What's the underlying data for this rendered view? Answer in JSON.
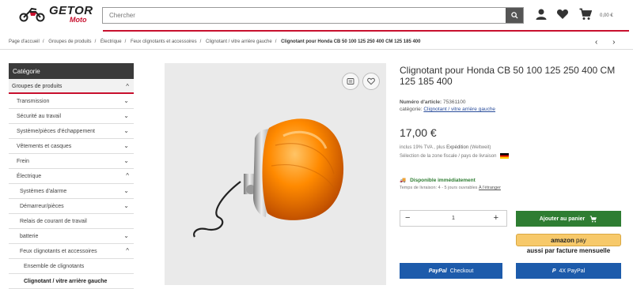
{
  "header": {
    "logo_text": "GETOR",
    "logo_sub": "Moto",
    "search_placeholder": "Chercher",
    "cart_total": "0,00 €"
  },
  "breadcrumb": [
    "Page d'accueil",
    "Groupes de produits",
    "Électrique",
    "Feux clignotants et accessoires",
    "Clignotant / vitre arrière gauche",
    "Clignotant pour Honda CB 50 100 125 250 400 CM 125 185 400"
  ],
  "sidebar": {
    "title": "Catégorie",
    "items": [
      {
        "label": "Groupes de produits",
        "chev": "^"
      },
      {
        "label": "Transmission",
        "chev": "⌄"
      },
      {
        "label": "Sécurité au travail",
        "chev": "⌄"
      },
      {
        "label": "Système/pièces d'échappement",
        "chev": "⌄"
      },
      {
        "label": "Vêtements et casques",
        "chev": "⌄"
      },
      {
        "label": "Frein",
        "chev": "⌄"
      },
      {
        "label": "Électrique",
        "chev": "^"
      },
      {
        "label": "Systèmes d'alarme",
        "chev": "⌄"
      },
      {
        "label": "Démarreur/pièces",
        "chev": "⌄"
      },
      {
        "label": "Relais de courant de travail",
        "chev": ""
      },
      {
        "label": "batterie",
        "chev": "⌄"
      },
      {
        "label": "Feux clignotants et accessoires",
        "chev": "^"
      },
      {
        "label": "Ensemble de clignotants",
        "chev": ""
      },
      {
        "label": "Clignotant / vitre arrière gauche",
        "chev": ""
      }
    ]
  },
  "product": {
    "title": "Clignotant pour Honda CB 50 100 125 250 400 CM 125 185 400",
    "article_label": "Numéro d'article:",
    "article_no": "75361100",
    "category_label": "catégorie:",
    "category_link": "Clignotant / vitre arrière gauche",
    "price": "17,00 €",
    "tax_prefix": "inclus 19% TVA , plus",
    "shipping_link": "Expédition",
    "shipping_suffix": "(Weltweit)",
    "zone_text": "Sélection de la zone fiscale / pays de livraison",
    "stock": "Disponible immédiatement",
    "delivery_prefix": "Temps de livraison: 4 - 5 jours ouvrables",
    "delivery_link": "À l'étranger",
    "qty": "1",
    "add_to_cart": "Ajouter au panier",
    "amazon_a": "amazon",
    "amazon_b": "pay",
    "amazon_sub": "aussi par facture mensuelle",
    "paypal_checkout_a": "PayPal",
    "paypal_checkout_b": "Checkout",
    "paypal_4x_a": "P",
    "paypal_4x_b": "4X PayPal"
  },
  "colors": {
    "brand_red": "#c8102e",
    "green": "#2e7d32",
    "paypal_blue": "#1d5bab",
    "amazon_yellow": "#f7c96a"
  }
}
